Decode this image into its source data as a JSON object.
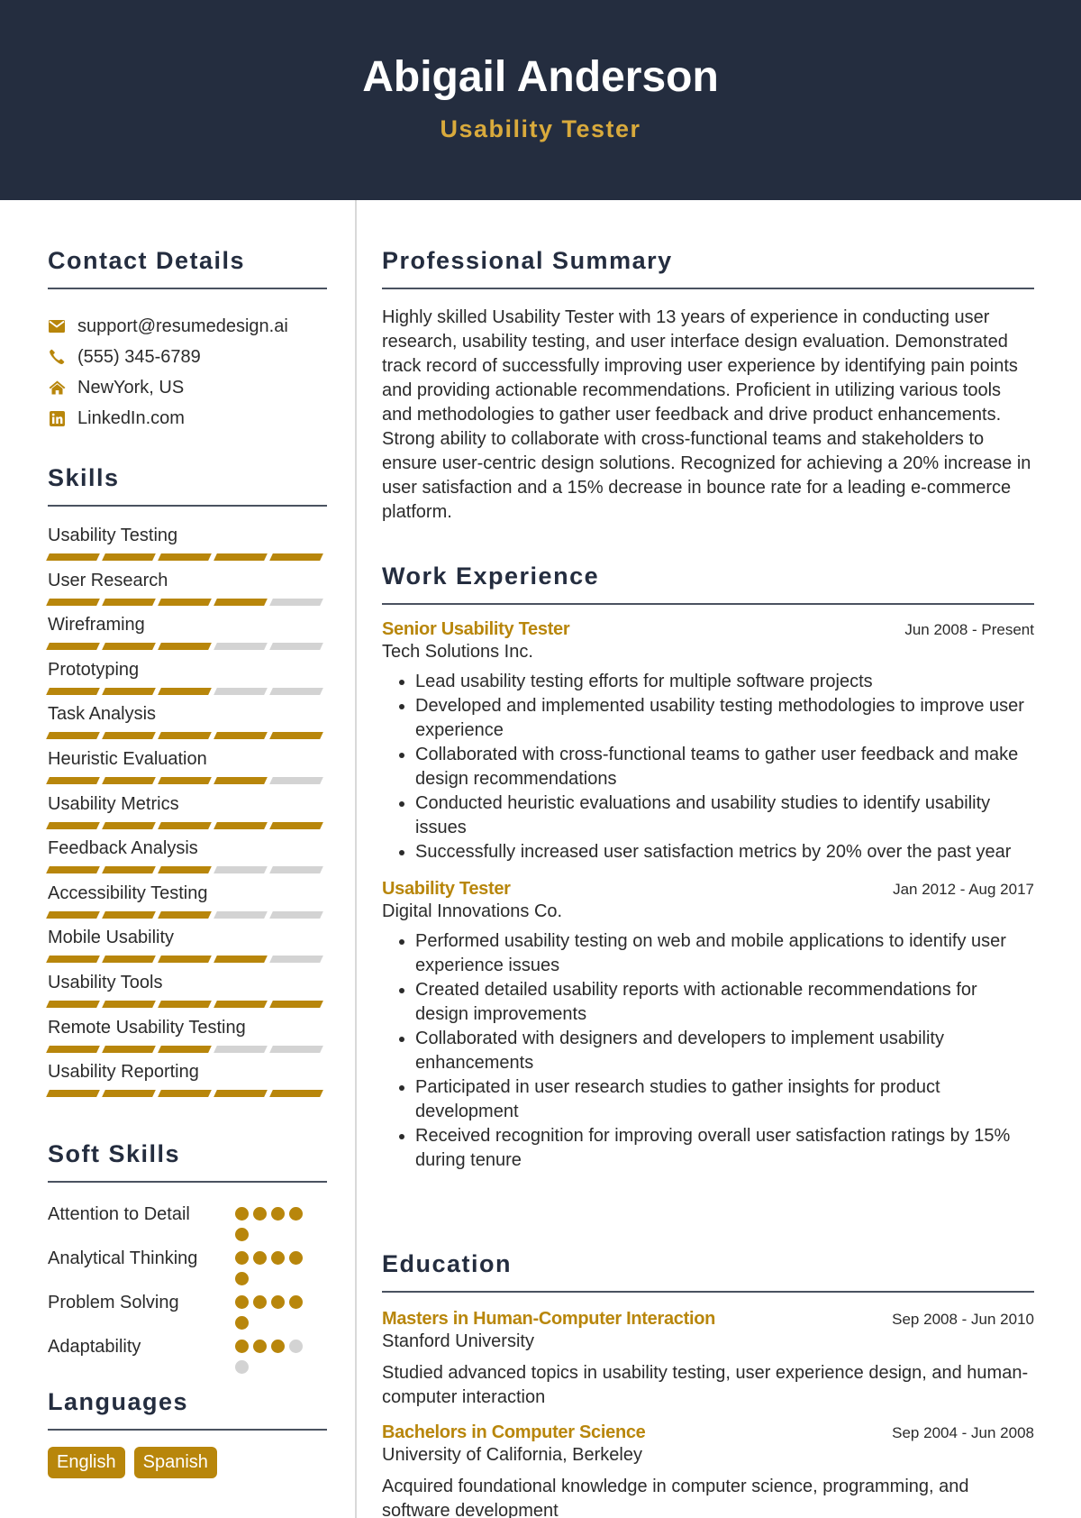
{
  "header": {
    "name": "Abigail Anderson",
    "role": "Usability Tester"
  },
  "colors": {
    "header_bg": "#242d3f",
    "accent": "#b8860b",
    "role_text": "#d9aa3c",
    "inactive": "#d3d3d3"
  },
  "contact": {
    "title": "Contact Details",
    "items": [
      {
        "icon": "envelope-icon",
        "text": "support@resumedesign.ai"
      },
      {
        "icon": "phone-icon",
        "text": "(555) 345-6789"
      },
      {
        "icon": "home-icon",
        "text": "NewYork, US"
      },
      {
        "icon": "linkedin-icon",
        "text": "LinkedIn.com"
      }
    ]
  },
  "skills": {
    "title": "Skills",
    "max_level": 5,
    "items": [
      {
        "name": "Usability Testing",
        "level": 5
      },
      {
        "name": "User Research",
        "level": 4
      },
      {
        "name": "Wireframing",
        "level": 3
      },
      {
        "name": "Prototyping",
        "level": 3
      },
      {
        "name": "Task Analysis",
        "level": 5
      },
      {
        "name": "Heuristic Evaluation",
        "level": 4
      },
      {
        "name": "Usability Metrics",
        "level": 5
      },
      {
        "name": "Feedback Analysis",
        "level": 3
      },
      {
        "name": "Accessibility Testing",
        "level": 3
      },
      {
        "name": "Mobile Usability",
        "level": 4
      },
      {
        "name": "Usability Tools",
        "level": 5
      },
      {
        "name": "Remote Usability Testing",
        "level": 3
      },
      {
        "name": "Usability Reporting",
        "level": 5
      }
    ]
  },
  "soft_skills": {
    "title": "Soft Skills",
    "max_level": 5,
    "items": [
      {
        "name": "Attention to Detail",
        "level": 5
      },
      {
        "name": "Analytical Thinking",
        "level": 5
      },
      {
        "name": "Problem Solving",
        "level": 5
      },
      {
        "name": "Adaptability",
        "level": 3
      }
    ]
  },
  "languages": {
    "title": "Languages",
    "items": [
      "English",
      "Spanish"
    ]
  },
  "summary": {
    "title": "Professional Summary",
    "text": "Highly skilled Usability Tester with 13 years of experience in conducting user research, usability testing, and user interface design evaluation. Demonstrated track record of successfully improving user experience by identifying pain points and providing actionable recommendations. Proficient in utilizing various tools and methodologies to gather user feedback and drive product enhancements. Strong ability to collaborate with cross-functional teams and stakeholders to ensure user-centric design solutions. Recognized for achieving a 20% increase in user satisfaction and a 15% decrease in bounce rate for a leading e-commerce platform."
  },
  "work": {
    "title": "Work Experience",
    "jobs": [
      {
        "title": "Senior Usability Tester",
        "date": "Jun 2008 - Present",
        "company": "Tech Solutions Inc.",
        "bullets": [
          "Lead usability testing efforts for multiple software projects",
          "Developed and implemented usability testing methodologies to improve user experience",
          "Collaborated with cross-functional teams to gather user feedback and make design recommendations",
          "Conducted heuristic evaluations and usability studies to identify usability issues",
          "Successfully increased user satisfaction metrics by 20% over the past year"
        ]
      },
      {
        "title": "Usability Tester",
        "date": "Jan 2012 - Aug 2017",
        "company": "Digital Innovations Co.",
        "bullets": [
          "Performed usability testing on web and mobile applications to identify user experience issues",
          "Created detailed usability reports with actionable recommendations for design improvements",
          "Collaborated with designers and developers to implement usability enhancements",
          "Participated in user research studies to gather insights for product development",
          "Received recognition for improving overall user satisfaction ratings by 15% during tenure"
        ]
      }
    ]
  },
  "education": {
    "title": "Education",
    "items": [
      {
        "degree": "Masters in Human-Computer Interaction",
        "date": "Sep 2008 - Jun 2010",
        "school": "Stanford University",
        "description": "Studied advanced topics in usability testing, user experience design, and human-computer interaction"
      },
      {
        "degree": "Bachelors in Computer Science",
        "date": "Sep 2004 - Jun 2008",
        "school": "University of California, Berkeley",
        "description": "Acquired foundational knowledge in computer science, programming, and software development"
      }
    ]
  }
}
